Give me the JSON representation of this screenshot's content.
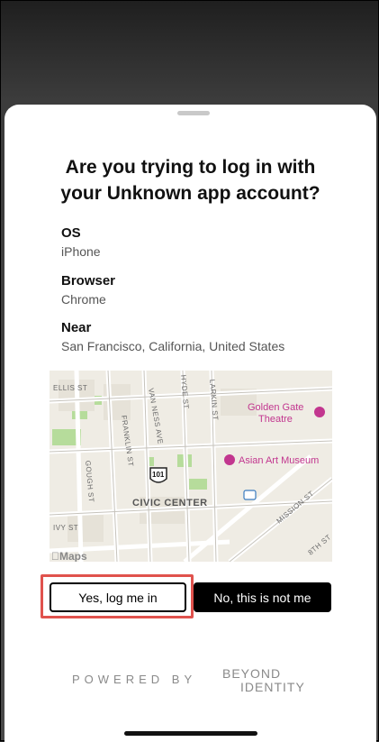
{
  "prompt": {
    "title_line1": "Are you trying to log in with",
    "title_line2": "your Unknown app account?"
  },
  "details": [
    {
      "label": "OS",
      "value": "iPhone"
    },
    {
      "label": "Browser",
      "value": "Chrome"
    },
    {
      "label": "Near",
      "value": "San Francisco, California, United States"
    }
  ],
  "map": {
    "provider": "Maps",
    "streets": [
      "ELLIS ST",
      "VAN NESS AVE",
      "FRANKLIN ST",
      "GOUGH ST",
      "LARKIN ST",
      "HYDE ST",
      "IVY ST",
      "MISSION ST",
      "8TH ST"
    ],
    "district": "CIVIC CENTER",
    "highway": "101",
    "pois": [
      {
        "name": "Golden Gate Theatre",
        "line1": "Golden Gate",
        "line2": "Theatre"
      },
      {
        "name": "Asian Art Museum"
      }
    ],
    "poi_color": "#c2368f"
  },
  "actions": {
    "confirm_label": "Yes, log me in",
    "deny_label": "No, this is not me",
    "highlight_color": "#e0524d"
  },
  "footer": {
    "powered_by": "POWERED BY",
    "brand_line1": "BEYOND",
    "brand_line2": "IDENTITY"
  }
}
